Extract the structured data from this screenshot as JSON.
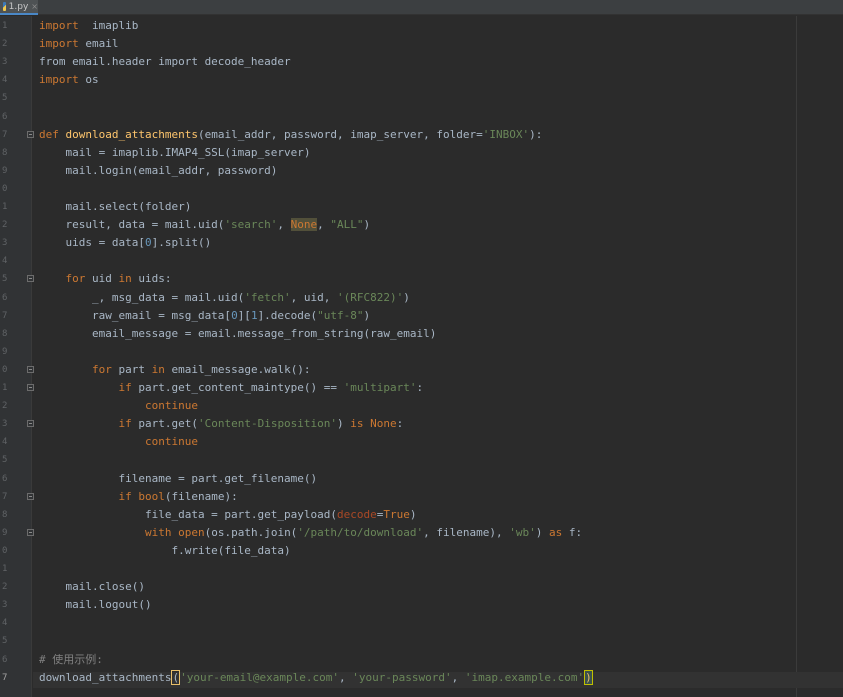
{
  "tab": {
    "filename": "1.py",
    "close_glyph": "×"
  },
  "editor": {
    "line_numbers": [
      "1",
      "2",
      "3",
      "4",
      "5",
      "6",
      "7",
      "8",
      "9",
      "0",
      "1",
      "2",
      "3",
      "4",
      "5",
      "6",
      "7",
      "8",
      "9",
      "0",
      "1",
      "2",
      "3",
      "4",
      "5",
      "6",
      "7",
      "8",
      "9",
      "0",
      "1",
      "2",
      "3",
      "4",
      "5",
      "6",
      "7"
    ],
    "lines": [
      {
        "segs": [
          [
            "kw",
            "import"
          ],
          [
            "",
            "  imaplib"
          ]
        ]
      },
      {
        "segs": [
          [
            "kw",
            "import"
          ],
          [
            "",
            " email"
          ]
        ]
      },
      {
        "segs": [
          [
            "",
            "from email.header import decode_header"
          ]
        ]
      },
      {
        "segs": [
          [
            "kw",
            "import"
          ],
          [
            "",
            " os"
          ]
        ]
      },
      {
        "segs": []
      },
      {
        "segs": []
      },
      {
        "segs": [
          [
            "kw",
            "def"
          ],
          [
            "",
            " "
          ],
          [
            "fn",
            "download_attachments"
          ],
          [
            "",
            "(email_addr, password, "
          ],
          [
            "",
            "imap_server"
          ],
          [
            "",
            ", folder="
          ],
          [
            "str",
            "'INBOX'"
          ],
          [
            "",
            "):"
          ]
        ]
      },
      {
        "segs": [
          [
            "",
            "    mail = imaplib.IMAP4_SSL(imap_server)"
          ]
        ]
      },
      {
        "segs": [
          [
            "",
            "    mail.login(email_addr, password)"
          ]
        ]
      },
      {
        "segs": []
      },
      {
        "segs": [
          [
            "",
            "    mail.select(folder)"
          ]
        ]
      },
      {
        "segs": [
          [
            "",
            "    result, data = mail.uid("
          ],
          [
            "str",
            "'search'"
          ],
          [
            "",
            ", "
          ],
          [
            "hl",
            "None"
          ],
          [
            "",
            ", "
          ],
          [
            "str",
            "\"ALL\""
          ],
          [
            "",
            ")"
          ]
        ]
      },
      {
        "segs": [
          [
            "",
            "    uids = data["
          ],
          [
            "num",
            "0"
          ],
          [
            "",
            "].split()"
          ]
        ]
      },
      {
        "segs": []
      },
      {
        "segs": [
          [
            "",
            "    "
          ],
          [
            "kw",
            "for"
          ],
          [
            "",
            " uid "
          ],
          [
            "kw",
            "in"
          ],
          [
            "",
            " uids:"
          ]
        ]
      },
      {
        "segs": [
          [
            "",
            "        _, msg_data = mail.uid("
          ],
          [
            "str",
            "'fetch'"
          ],
          [
            "",
            ", uid, "
          ],
          [
            "str",
            "'(RFC822)'"
          ],
          [
            "",
            ")"
          ]
        ]
      },
      {
        "segs": [
          [
            "",
            "        raw_email = msg_data["
          ],
          [
            "num",
            "0"
          ],
          [
            "",
            "]["
          ],
          [
            "num",
            "1"
          ],
          [
            "",
            "].decode("
          ],
          [
            "str",
            "\"utf-8\""
          ],
          [
            "",
            ")"
          ]
        ]
      },
      {
        "segs": [
          [
            "",
            "        email_message = email.message_from_string(raw_email)"
          ]
        ]
      },
      {
        "segs": []
      },
      {
        "segs": [
          [
            "",
            "        "
          ],
          [
            "kw",
            "for"
          ],
          [
            "",
            " part "
          ],
          [
            "kw",
            "in"
          ],
          [
            "",
            " email_message.walk():"
          ]
        ]
      },
      {
        "segs": [
          [
            "",
            "            "
          ],
          [
            "kw",
            "if"
          ],
          [
            "",
            " part.get_content_maintype() == "
          ],
          [
            "str",
            "'multipart'"
          ],
          [
            "",
            ":"
          ]
        ]
      },
      {
        "segs": [
          [
            "",
            "                "
          ],
          [
            "kw",
            "continue"
          ]
        ]
      },
      {
        "segs": [
          [
            "",
            "            "
          ],
          [
            "kw",
            "if"
          ],
          [
            "",
            " part.get("
          ],
          [
            "str",
            "'Content-Disposition'"
          ],
          [
            "",
            ") "
          ],
          [
            "kw",
            "is"
          ],
          [
            "",
            " "
          ],
          [
            "kw",
            "None"
          ],
          [
            "",
            ":"
          ]
        ]
      },
      {
        "segs": [
          [
            "",
            "                "
          ],
          [
            "kw",
            "continue"
          ]
        ]
      },
      {
        "segs": []
      },
      {
        "segs": [
          [
            "",
            "            filename = part.get_filename()"
          ]
        ]
      },
      {
        "segs": [
          [
            "",
            "            "
          ],
          [
            "kw",
            "if"
          ],
          [
            "",
            " "
          ],
          [
            "kw",
            "bool"
          ],
          [
            "",
            "(filename):"
          ]
        ]
      },
      {
        "segs": [
          [
            "",
            "                file_data = part.get_payload("
          ],
          [
            "kwarg",
            "decode"
          ],
          [
            "",
            "="
          ],
          [
            "kw",
            "True"
          ],
          [
            "",
            ")"
          ]
        ]
      },
      {
        "segs": [
          [
            "",
            "                "
          ],
          [
            "kw",
            "with"
          ],
          [
            "",
            " "
          ],
          [
            "kw",
            "open"
          ],
          [
            "",
            "(os.path.join("
          ],
          [
            "str",
            "'/path/to/download'"
          ],
          [
            "",
            ", filename), "
          ],
          [
            "str",
            "'wb'"
          ],
          [
            "",
            ") "
          ],
          [
            "kw",
            "as"
          ],
          [
            "",
            " f:"
          ]
        ]
      },
      {
        "segs": [
          [
            "",
            "                    f.write(file_data)"
          ]
        ]
      },
      {
        "segs": []
      },
      {
        "segs": [
          [
            "",
            "    mail.close()"
          ]
        ]
      },
      {
        "segs": [
          [
            "",
            "    mail.logout()"
          ]
        ]
      },
      {
        "segs": []
      },
      {
        "segs": []
      },
      {
        "segs": [
          [
            "cmt",
            "# 使用示例:"
          ]
        ]
      },
      {
        "segs": [
          [
            "",
            "download_attachments"
          ],
          [
            "caret-bracket",
            "("
          ],
          [
            "str",
            "'your-email@example.com'"
          ],
          [
            "",
            ", "
          ],
          [
            "str",
            "'your-password'"
          ],
          [
            "",
            ", "
          ],
          [
            "str",
            "'imap.example.com'"
          ],
          [
            "caret-end",
            ")"
          ]
        ]
      }
    ]
  },
  "colors": {
    "background": "#2b2b2b",
    "keyword": "#cc7832",
    "function": "#ffc66d",
    "string": "#6a8759",
    "number": "#6897bb",
    "comment": "#808080"
  }
}
